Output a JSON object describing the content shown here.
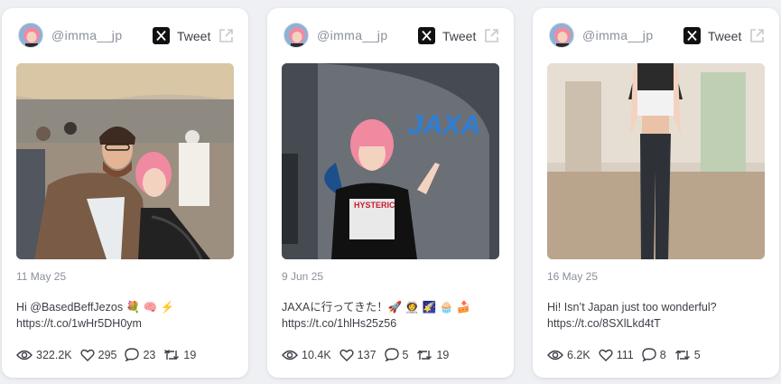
{
  "cards": [
    {
      "handle": "@imma__jp",
      "tweet_label": "Tweet",
      "date": "11 May 25",
      "text": "Hi @BasedBeffJezos 💐 🧠 ⚡",
      "link": "https://t.co/1wHr5DH0ym",
      "views": "322.2K",
      "likes": "295",
      "replies": "23",
      "retweets": "19"
    },
    {
      "handle": "@imma__jp",
      "tweet_label": "Tweet",
      "date": "9 Jun 25",
      "text": "JAXAに行ってきた！🚀 👩‍🚀 🌠 🧁 🍰",
      "link": "https://t.co/1hlHs25z56",
      "views": "10.4K",
      "likes": "137",
      "replies": "5",
      "retweets": "19",
      "photo_sign": "JAXA"
    },
    {
      "handle": "@imma__jp",
      "tweet_label": "Tweet",
      "date": "16 May 25",
      "text": "Hi! Isn’t Japan just too wonderful?",
      "link": "https://t.co/8SXlLkd4tT",
      "views": "6.2K",
      "likes": "111",
      "replies": "8",
      "retweets": "5"
    }
  ],
  "icons": {
    "x_logo": "x-logo-icon",
    "external": "external-link-icon",
    "views": "eye-icon",
    "likes": "heart-icon",
    "replies": "comment-icon",
    "retweets": "retweet-icon"
  },
  "colors": {
    "muted": "#8a909a",
    "text": "#3b3f46",
    "avatar_hair": "#f08aa0"
  }
}
